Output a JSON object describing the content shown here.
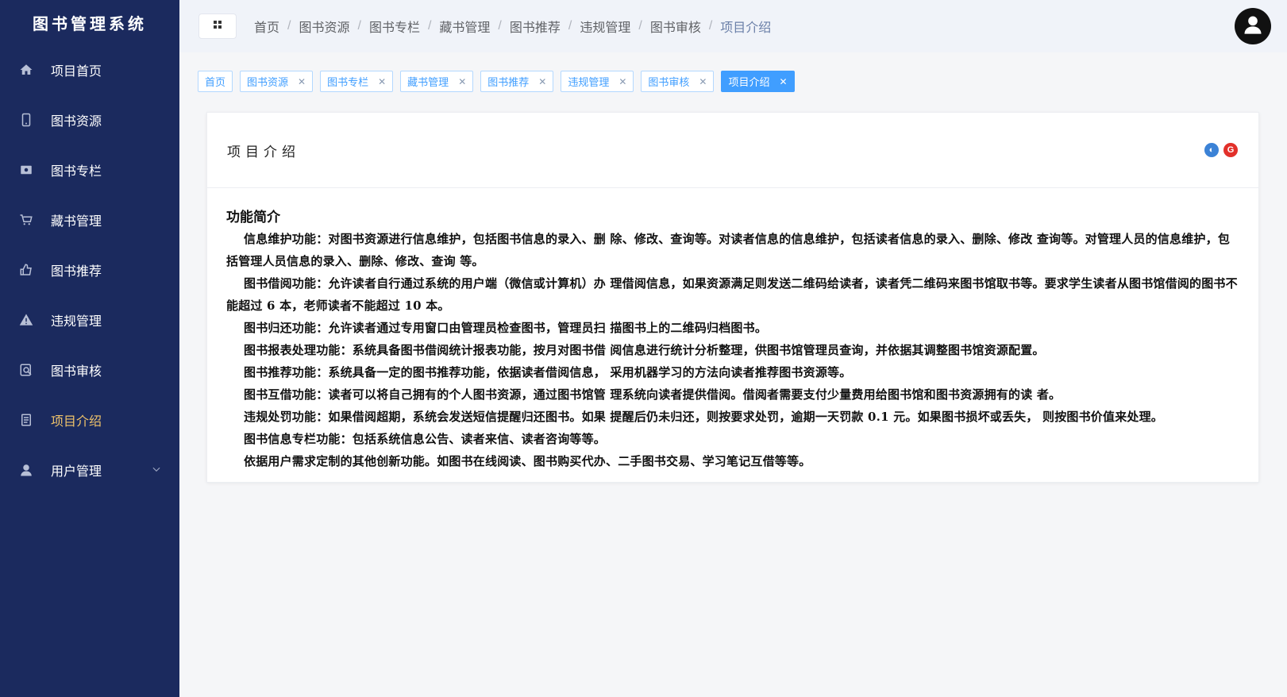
{
  "app": {
    "title": "图书管理系统"
  },
  "sidebar": {
    "items": [
      {
        "label": "项目首页",
        "icon": "home-icon"
      },
      {
        "label": "图书资源",
        "icon": "phone-icon"
      },
      {
        "label": "图书专栏",
        "icon": "image-icon"
      },
      {
        "label": "藏书管理",
        "icon": "cart-icon"
      },
      {
        "label": "图书推荐",
        "icon": "thumb-up-icon"
      },
      {
        "label": "违规管理",
        "icon": "warning-icon"
      },
      {
        "label": "图书审核",
        "icon": "search-doc-icon"
      },
      {
        "label": "项目介绍",
        "icon": "document-icon",
        "active": true
      },
      {
        "label": "用户管理",
        "icon": "user-icon",
        "expandable": true
      }
    ]
  },
  "header": {
    "breadcrumb": [
      "首页",
      "图书资源",
      "图书专栏",
      "藏书管理",
      "图书推荐",
      "违规管理",
      "图书审核",
      "项目介绍"
    ],
    "separator": "/"
  },
  "tags": [
    {
      "label": "首页",
      "closable": false
    },
    {
      "label": "图书资源",
      "closable": true
    },
    {
      "label": "图书专栏",
      "closable": true
    },
    {
      "label": "藏书管理",
      "closable": true
    },
    {
      "label": "图书推荐",
      "closable": true
    },
    {
      "label": "违规管理",
      "closable": true
    },
    {
      "label": "图书审核",
      "closable": true
    },
    {
      "label": "项目介绍",
      "closable": true,
      "active": true
    }
  ],
  "card": {
    "title": "项目介绍",
    "section_title": "功能简介",
    "paragraphs": [
      "信息维护功能：对图书资源进行信息维护，包括图书信息的录入、删 除、修改、查询等。对读者信息的信息维护，包括读者信息的录入、删除、修改 查询等。对管理人员的信息维护，包括管理人员信息的录入、删除、修改、查询 等。",
      "图书借阅功能：允许读者自行通过系统的用户端（微信或计算机）办 理借阅信息，如果资源满足则发送二维码给读者，读者凭二维码来图书馆取书等。要求学生读者从图书馆借阅的图书不能超过 6 本，老师读者不能超过 10 本。",
      "图书归还功能：允许读者通过专用窗口由管理员检查图书，管理员扫 描图书上的二维码归档图书。",
      "图书报表处理功能：系统具备图书借阅统计报表功能，按月对图书借 阅信息进行统计分析整理，供图书馆管理员查询，并依据其调整图书馆资源配置。",
      "图书推荐功能：系统具备一定的图书推荐功能，依据读者借阅信息， 采用机器学习的方法向读者推荐图书资源等。",
      "图书互借功能：读者可以将自己拥有的个人图书资源，通过图书馆管 理系统向读者提供借阅。借阅者需要支付少量费用给图书馆和图书资源拥有的读 者。",
      "违规处罚功能：如果借阅超期，系统会发送短信提醒归还图书。如果 提醒后仍未归还，则按要求处罚，逾期一天罚款 0.1 元。如果图书损坏或丢失， 则按图书价值来处理。",
      "图书信息专栏功能：包括系统信息公告、读者来信、读者咨询等等。",
      "依据用户需求定制的其他创新功能。如图书在线阅读、图书购买代办、二手图书交易、学习笔记互借等等。"
    ]
  },
  "colors": {
    "sidebar_bg": "#1b2a5e",
    "active_menu": "#f0c36a",
    "tag_active": "#409eff"
  }
}
